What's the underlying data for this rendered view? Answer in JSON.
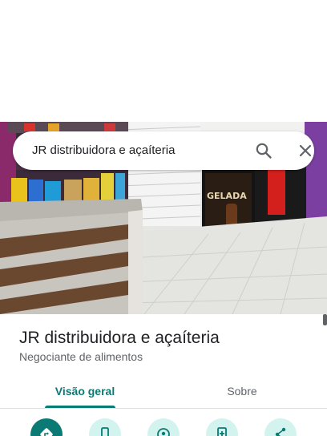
{
  "search": {
    "query": "JR distribuidora e açaíteria"
  },
  "place": {
    "name": "JR distribuidora e açaíteria",
    "category": "Negociante de alimentos"
  },
  "photo": {
    "sign_text": "GELADA"
  },
  "tabs": [
    {
      "label": "Visão geral",
      "active": true
    },
    {
      "label": "Sobre",
      "active": false
    }
  ],
  "actions": [
    {
      "icon": "directions-icon"
    },
    {
      "icon": "phone-icon"
    },
    {
      "icon": "location-share-icon"
    },
    {
      "icon": "save-icon"
    },
    {
      "icon": "share-icon"
    }
  ],
  "colors": {
    "accent": "#0b7a75",
    "action_bg": "#d3f3ee",
    "text_primary": "#202124",
    "text_secondary": "#5f6368"
  }
}
